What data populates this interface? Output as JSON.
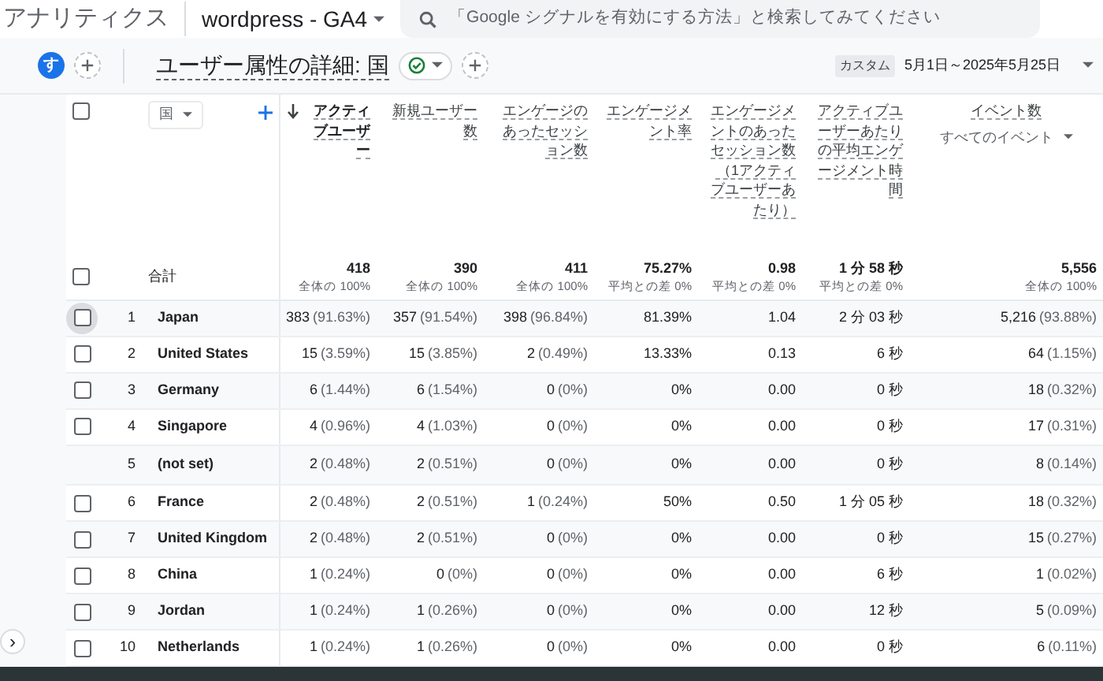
{
  "app_bar": {
    "app_name": "アナリティクス",
    "property": "wordpress - GA4",
    "search": {
      "placeholder": "「Google シグナルを有効にする方法」と検索してみてください"
    }
  },
  "toolbar": {
    "avatar": "す",
    "title": "ユーザー属性の詳細: 国",
    "date_badge": "カスタム",
    "date_range": "5月1日～2025年5月25日"
  },
  "expand_button": "›",
  "table": {
    "header_checked": false,
    "dimension": "国",
    "columns": [
      {
        "label": "アクティブユーザー",
        "sorted": true
      },
      {
        "label": "新規ユーザー数",
        "sorted": false
      },
      {
        "label": "エンゲージのあったセッション数",
        "sorted": false
      },
      {
        "label": "エンゲージメント率",
        "sorted": false
      },
      {
        "label": "エンゲージメントのあったセッション数（1アクティブユーザーあたり）",
        "sorted": false
      },
      {
        "label": "アクティブユーザーあたりの平均エンゲージメント時間",
        "sorted": false
      },
      {
        "label": "イベント数",
        "sorted": false,
        "filter": "すべてのイベント"
      }
    ],
    "totals": {
      "label": "合計",
      "checked": false,
      "cells": [
        {
          "value": "418",
          "note": "全体の 100%"
        },
        {
          "value": "390",
          "note": "全体の 100%"
        },
        {
          "value": "411",
          "note": "全体の 100%"
        },
        {
          "value": "75.27%",
          "note": "平均との差 0%"
        },
        {
          "value": "0.98",
          "note": "平均との差 0%"
        },
        {
          "value": "1 分 58 秒",
          "note": "平均との差 0%"
        },
        {
          "value": "5,556",
          "note": "全体の 100%"
        }
      ]
    },
    "rows": [
      {
        "rank": "1",
        "country": "Japan",
        "kind": "selectable",
        "checked": false,
        "hovered": true,
        "cells": [
          {
            "value": "383",
            "share": "(91.63%)"
          },
          {
            "value": "357",
            "share": "(91.54%)"
          },
          {
            "value": "398",
            "share": "(96.84%)"
          },
          {
            "value": "81.39%"
          },
          {
            "value": "1.04"
          },
          {
            "value": "2 分 03 秒"
          },
          {
            "value": "5,216",
            "share": "(93.88%)"
          }
        ]
      },
      {
        "rank": "2",
        "country": "United States",
        "kind": "selectable",
        "checked": false,
        "hovered": false,
        "cells": [
          {
            "value": "15",
            "share": "(3.59%)"
          },
          {
            "value": "15",
            "share": "(3.85%)"
          },
          {
            "value": "2",
            "share": "(0.49%)"
          },
          {
            "value": "13.33%"
          },
          {
            "value": "0.13"
          },
          {
            "value": "6 秒"
          },
          {
            "value": "64",
            "share": "(1.15%)"
          }
        ]
      },
      {
        "rank": "3",
        "country": "Germany",
        "kind": "selectable",
        "checked": false,
        "hovered": false,
        "cells": [
          {
            "value": "6",
            "share": "(1.44%)"
          },
          {
            "value": "6",
            "share": "(1.54%)"
          },
          {
            "value": "0",
            "share": "(0%)"
          },
          {
            "value": "0%"
          },
          {
            "value": "0.00"
          },
          {
            "value": "0 秒"
          },
          {
            "value": "18",
            "share": "(0.32%)"
          }
        ]
      },
      {
        "rank": "4",
        "country": "Singapore",
        "kind": "selectable",
        "checked": false,
        "hovered": false,
        "cells": [
          {
            "value": "4",
            "share": "(0.96%)"
          },
          {
            "value": "4",
            "share": "(1.03%)"
          },
          {
            "value": "0",
            "share": "(0%)"
          },
          {
            "value": "0%"
          },
          {
            "value": "0.00"
          },
          {
            "value": "0 秒"
          },
          {
            "value": "17",
            "share": "(0.31%)"
          }
        ]
      },
      {
        "rank": "5",
        "country": "(not set)",
        "kind": "plain",
        "hovered": false,
        "cells": [
          {
            "value": "2",
            "share": "(0.48%)"
          },
          {
            "value": "2",
            "share": "(0.51%)"
          },
          {
            "value": "0",
            "share": "(0%)"
          },
          {
            "value": "0%"
          },
          {
            "value": "0.00"
          },
          {
            "value": "0 秒"
          },
          {
            "value": "8",
            "share": "(0.14%)"
          }
        ]
      },
      {
        "rank": "6",
        "country": "France",
        "kind": "selectable",
        "checked": false,
        "hovered": false,
        "cells": [
          {
            "value": "2",
            "share": "(0.48%)"
          },
          {
            "value": "2",
            "share": "(0.51%)"
          },
          {
            "value": "1",
            "share": "(0.24%)"
          },
          {
            "value": "50%"
          },
          {
            "value": "0.50"
          },
          {
            "value": "1 分 05 秒"
          },
          {
            "value": "18",
            "share": "(0.32%)"
          }
        ]
      },
      {
        "rank": "7",
        "country": "United Kingdom",
        "kind": "selectable",
        "checked": false,
        "hovered": false,
        "cells": [
          {
            "value": "2",
            "share": "(0.48%)"
          },
          {
            "value": "2",
            "share": "(0.51%)"
          },
          {
            "value": "0",
            "share": "(0%)"
          },
          {
            "value": "0%"
          },
          {
            "value": "0.00"
          },
          {
            "value": "0 秒"
          },
          {
            "value": "15",
            "share": "(0.27%)"
          }
        ]
      },
      {
        "rank": "8",
        "country": "China",
        "kind": "selectable",
        "checked": false,
        "hovered": false,
        "cells": [
          {
            "value": "1",
            "share": "(0.24%)"
          },
          {
            "value": "0",
            "share": "(0%)"
          },
          {
            "value": "0",
            "share": "(0%)"
          },
          {
            "value": "0%"
          },
          {
            "value": "0.00"
          },
          {
            "value": "6 秒"
          },
          {
            "value": "1",
            "share": "(0.02%)"
          }
        ]
      },
      {
        "rank": "9",
        "country": "Jordan",
        "kind": "selectable",
        "checked": false,
        "hovered": false,
        "cells": [
          {
            "value": "1",
            "share": "(0.24%)"
          },
          {
            "value": "1",
            "share": "(0.26%)"
          },
          {
            "value": "0",
            "share": "(0%)"
          },
          {
            "value": "0%"
          },
          {
            "value": "0.00"
          },
          {
            "value": "12 秒"
          },
          {
            "value": "5",
            "share": "(0.09%)"
          }
        ]
      },
      {
        "rank": "10",
        "country": "Netherlands",
        "kind": "selectable",
        "checked": false,
        "hovered": false,
        "cells": [
          {
            "value": "1",
            "share": "(0.24%)"
          },
          {
            "value": "1",
            "share": "(0.26%)"
          },
          {
            "value": "0",
            "share": "(0%)"
          },
          {
            "value": "0%"
          },
          {
            "value": "0.00"
          },
          {
            "value": "0 秒"
          },
          {
            "value": "6",
            "share": "(0.11%)"
          }
        ]
      }
    ]
  }
}
